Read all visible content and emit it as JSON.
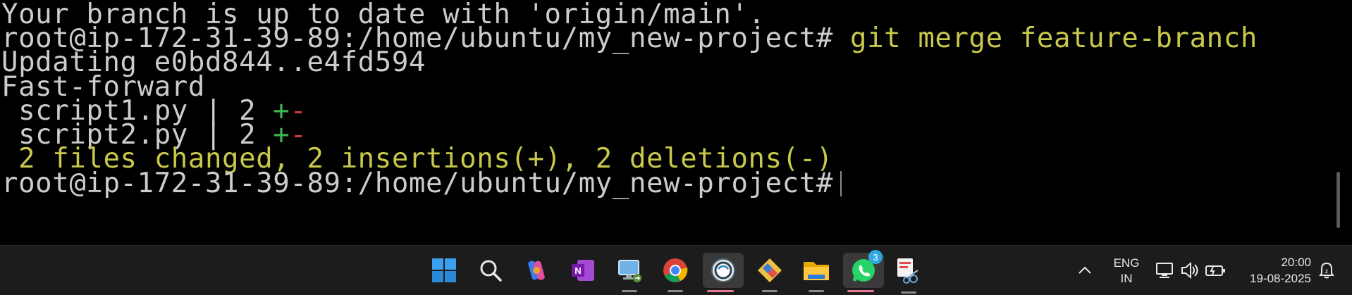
{
  "terminal": {
    "lines": [
      {
        "text": "Your branch is up to date with 'origin/main'."
      },
      {
        "prompt": "root@ip-172-31-39-89:/home/ubuntu/my_new-project#",
        "command": " git merge feature-branch"
      },
      {
        "text": "Updating e0bd844..e4fd594"
      },
      {
        "text": "Fast-forward"
      },
      {
        "file": " script1.py | 2 ",
        "plus": "+",
        "minus": "-"
      },
      {
        "file": " script2.py | 2 ",
        "plus": "+",
        "minus": "-"
      },
      {
        "text": " 2 files changed, 2 insertions(+), 2 deletions(-)"
      },
      {
        "prompt": "root@ip-172-31-39-89:/home/ubuntu/my_new-project#"
      }
    ]
  },
  "taskbar": {
    "icons": [
      "windows-start-icon",
      "search-icon",
      "copilot-icon",
      "onenote-icon",
      "remote-desktop-icon",
      "chrome-icon",
      "terminal-app-icon",
      "git-icon",
      "file-explorer-icon",
      "whatsapp-icon",
      "snipping-tool-icon"
    ],
    "whatsapp_badge": "3",
    "language_line1": "ENG",
    "language_line2": "IN",
    "time": "20:00",
    "date": "19-08-2025"
  }
}
